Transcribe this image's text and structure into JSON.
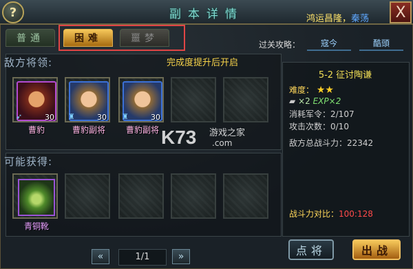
{
  "title": "副本详情",
  "banner_text_yellow": "鸿运昌隆，",
  "banner_text_blue": "秦荡",
  "tabs": [
    {
      "label": "普通"
    },
    {
      "label": "困难"
    },
    {
      "label": "噩梦"
    }
  ],
  "strategy": {
    "label": "过关攻略：",
    "links": [
      "寇今",
      "酷頭"
    ]
  },
  "enemies": {
    "section_label": "敌方将领:",
    "unlock_hint": "完成度提升后开启",
    "generals": [
      {
        "name": "曹豹",
        "level": "30"
      },
      {
        "name": "曹豹副将",
        "level": "30"
      },
      {
        "name": "曹豹副将",
        "level": "30"
      }
    ]
  },
  "loot": {
    "section_label": "可能获得:",
    "items": [
      {
        "name": "青铜靴"
      }
    ]
  },
  "pager": {
    "text": "1/1",
    "prev": "«",
    "next": "»"
  },
  "info": {
    "stage_title": "5-2 征讨陶谦",
    "difficulty_label": "难度：",
    "difficulty_stars": 2,
    "reward_item": "×2",
    "reward_exp": "EXP×2",
    "cost": "消耗军令：2/107",
    "attacks": "攻击次数：0/10",
    "enemy_power": "敌方总战斗力：22342",
    "compare_label": "战斗力对比：",
    "compare_value": "100:128"
  },
  "buttons": {
    "general": "点将",
    "battle": "出战",
    "help": "?",
    "close": "X"
  },
  "watermark": {
    "logo": "K73",
    "cn": "游戏之家",
    "com": ".com"
  },
  "colors": {
    "accent_gold": "#f6c85a",
    "title_teal": "#7fd9d0",
    "highlight_red": "#e24545"
  }
}
